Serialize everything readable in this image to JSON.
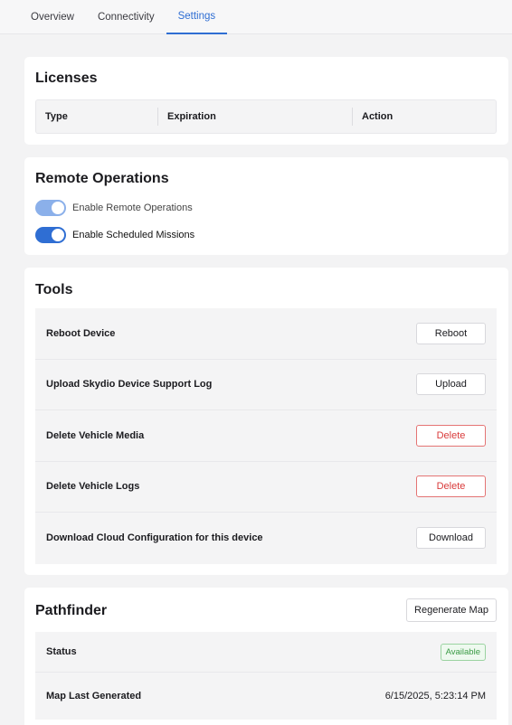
{
  "tabs": [
    "Overview",
    "Connectivity",
    "Settings"
  ],
  "active_tab": "Settings",
  "licenses": {
    "title": "Licenses",
    "columns": [
      "Type",
      "Expiration",
      "Action"
    ]
  },
  "remote_operations": {
    "title": "Remote Operations",
    "toggles": [
      {
        "label": "Enable Remote Operations",
        "on": true,
        "disabled": true
      },
      {
        "label": "Enable Scheduled Missions",
        "on": true,
        "disabled": false
      }
    ]
  },
  "tools": {
    "title": "Tools",
    "rows": [
      {
        "label": "Reboot Device",
        "button": "Reboot",
        "danger": false
      },
      {
        "label": "Upload Skydio Device Support Log",
        "button": "Upload",
        "danger": false
      },
      {
        "label": "Delete Vehicle Media",
        "button": "Delete",
        "danger": true
      },
      {
        "label": "Delete Vehicle Logs",
        "button": "Delete",
        "danger": true
      },
      {
        "label": "Download Cloud Configuration for this device",
        "button": "Download",
        "danger": false
      }
    ]
  },
  "pathfinder": {
    "title": "Pathfinder",
    "regenerate_label": "Regenerate Map",
    "status_label": "Status",
    "status_value": "Available",
    "last_generated_label": "Map Last Generated",
    "last_generated_value": "6/15/2025, 5:23:14 PM"
  },
  "colors": {
    "accent": "#2f6ed3",
    "accent_disabled": "#8bb0ea",
    "danger": "#d93a3a",
    "success": "#3a9b45"
  }
}
